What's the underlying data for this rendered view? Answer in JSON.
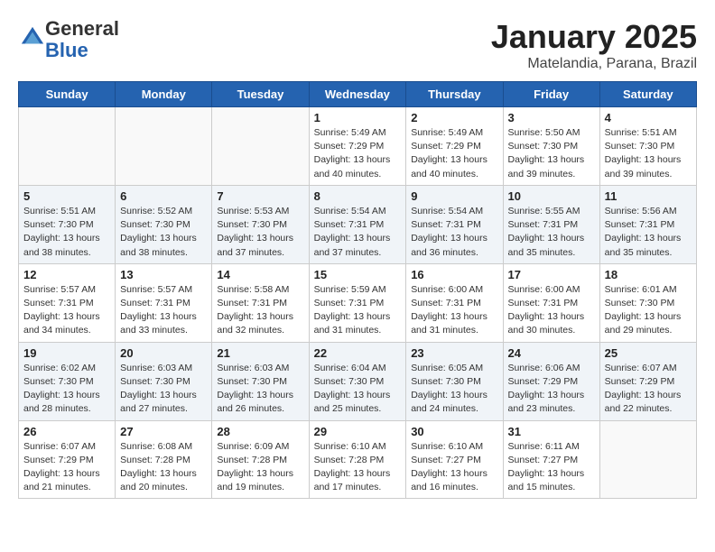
{
  "header": {
    "logo_general": "General",
    "logo_blue": "Blue",
    "calendar_title": "January 2025",
    "calendar_subtitle": "Matelandia, Parana, Brazil"
  },
  "weekdays": [
    "Sunday",
    "Monday",
    "Tuesday",
    "Wednesday",
    "Thursday",
    "Friday",
    "Saturday"
  ],
  "weeks": [
    [
      {
        "day": "",
        "sunrise": "",
        "sunset": "",
        "daylight": ""
      },
      {
        "day": "",
        "sunrise": "",
        "sunset": "",
        "daylight": ""
      },
      {
        "day": "",
        "sunrise": "",
        "sunset": "",
        "daylight": ""
      },
      {
        "day": "1",
        "sunrise": "Sunrise: 5:49 AM",
        "sunset": "Sunset: 7:29 PM",
        "daylight": "Daylight: 13 hours and 40 minutes."
      },
      {
        "day": "2",
        "sunrise": "Sunrise: 5:49 AM",
        "sunset": "Sunset: 7:29 PM",
        "daylight": "Daylight: 13 hours and 40 minutes."
      },
      {
        "day": "3",
        "sunrise": "Sunrise: 5:50 AM",
        "sunset": "Sunset: 7:30 PM",
        "daylight": "Daylight: 13 hours and 39 minutes."
      },
      {
        "day": "4",
        "sunrise": "Sunrise: 5:51 AM",
        "sunset": "Sunset: 7:30 PM",
        "daylight": "Daylight: 13 hours and 39 minutes."
      }
    ],
    [
      {
        "day": "5",
        "sunrise": "Sunrise: 5:51 AM",
        "sunset": "Sunset: 7:30 PM",
        "daylight": "Daylight: 13 hours and 38 minutes."
      },
      {
        "day": "6",
        "sunrise": "Sunrise: 5:52 AM",
        "sunset": "Sunset: 7:30 PM",
        "daylight": "Daylight: 13 hours and 38 minutes."
      },
      {
        "day": "7",
        "sunrise": "Sunrise: 5:53 AM",
        "sunset": "Sunset: 7:30 PM",
        "daylight": "Daylight: 13 hours and 37 minutes."
      },
      {
        "day": "8",
        "sunrise": "Sunrise: 5:54 AM",
        "sunset": "Sunset: 7:31 PM",
        "daylight": "Daylight: 13 hours and 37 minutes."
      },
      {
        "day": "9",
        "sunrise": "Sunrise: 5:54 AM",
        "sunset": "Sunset: 7:31 PM",
        "daylight": "Daylight: 13 hours and 36 minutes."
      },
      {
        "day": "10",
        "sunrise": "Sunrise: 5:55 AM",
        "sunset": "Sunset: 7:31 PM",
        "daylight": "Daylight: 13 hours and 35 minutes."
      },
      {
        "day": "11",
        "sunrise": "Sunrise: 5:56 AM",
        "sunset": "Sunset: 7:31 PM",
        "daylight": "Daylight: 13 hours and 35 minutes."
      }
    ],
    [
      {
        "day": "12",
        "sunrise": "Sunrise: 5:57 AM",
        "sunset": "Sunset: 7:31 PM",
        "daylight": "Daylight: 13 hours and 34 minutes."
      },
      {
        "day": "13",
        "sunrise": "Sunrise: 5:57 AM",
        "sunset": "Sunset: 7:31 PM",
        "daylight": "Daylight: 13 hours and 33 minutes."
      },
      {
        "day": "14",
        "sunrise": "Sunrise: 5:58 AM",
        "sunset": "Sunset: 7:31 PM",
        "daylight": "Daylight: 13 hours and 32 minutes."
      },
      {
        "day": "15",
        "sunrise": "Sunrise: 5:59 AM",
        "sunset": "Sunset: 7:31 PM",
        "daylight": "Daylight: 13 hours and 31 minutes."
      },
      {
        "day": "16",
        "sunrise": "Sunrise: 6:00 AM",
        "sunset": "Sunset: 7:31 PM",
        "daylight": "Daylight: 13 hours and 31 minutes."
      },
      {
        "day": "17",
        "sunrise": "Sunrise: 6:00 AM",
        "sunset": "Sunset: 7:31 PM",
        "daylight": "Daylight: 13 hours and 30 minutes."
      },
      {
        "day": "18",
        "sunrise": "Sunrise: 6:01 AM",
        "sunset": "Sunset: 7:30 PM",
        "daylight": "Daylight: 13 hours and 29 minutes."
      }
    ],
    [
      {
        "day": "19",
        "sunrise": "Sunrise: 6:02 AM",
        "sunset": "Sunset: 7:30 PM",
        "daylight": "Daylight: 13 hours and 28 minutes."
      },
      {
        "day": "20",
        "sunrise": "Sunrise: 6:03 AM",
        "sunset": "Sunset: 7:30 PM",
        "daylight": "Daylight: 13 hours and 27 minutes."
      },
      {
        "day": "21",
        "sunrise": "Sunrise: 6:03 AM",
        "sunset": "Sunset: 7:30 PM",
        "daylight": "Daylight: 13 hours and 26 minutes."
      },
      {
        "day": "22",
        "sunrise": "Sunrise: 6:04 AM",
        "sunset": "Sunset: 7:30 PM",
        "daylight": "Daylight: 13 hours and 25 minutes."
      },
      {
        "day": "23",
        "sunrise": "Sunrise: 6:05 AM",
        "sunset": "Sunset: 7:30 PM",
        "daylight": "Daylight: 13 hours and 24 minutes."
      },
      {
        "day": "24",
        "sunrise": "Sunrise: 6:06 AM",
        "sunset": "Sunset: 7:29 PM",
        "daylight": "Daylight: 13 hours and 23 minutes."
      },
      {
        "day": "25",
        "sunrise": "Sunrise: 6:07 AM",
        "sunset": "Sunset: 7:29 PM",
        "daylight": "Daylight: 13 hours and 22 minutes."
      }
    ],
    [
      {
        "day": "26",
        "sunrise": "Sunrise: 6:07 AM",
        "sunset": "Sunset: 7:29 PM",
        "daylight": "Daylight: 13 hours and 21 minutes."
      },
      {
        "day": "27",
        "sunrise": "Sunrise: 6:08 AM",
        "sunset": "Sunset: 7:28 PM",
        "daylight": "Daylight: 13 hours and 20 minutes."
      },
      {
        "day": "28",
        "sunrise": "Sunrise: 6:09 AM",
        "sunset": "Sunset: 7:28 PM",
        "daylight": "Daylight: 13 hours and 19 minutes."
      },
      {
        "day": "29",
        "sunrise": "Sunrise: 6:10 AM",
        "sunset": "Sunset: 7:28 PM",
        "daylight": "Daylight: 13 hours and 17 minutes."
      },
      {
        "day": "30",
        "sunrise": "Sunrise: 6:10 AM",
        "sunset": "Sunset: 7:27 PM",
        "daylight": "Daylight: 13 hours and 16 minutes."
      },
      {
        "day": "31",
        "sunrise": "Sunrise: 6:11 AM",
        "sunset": "Sunset: 7:27 PM",
        "daylight": "Daylight: 13 hours and 15 minutes."
      },
      {
        "day": "",
        "sunrise": "",
        "sunset": "",
        "daylight": ""
      }
    ]
  ]
}
